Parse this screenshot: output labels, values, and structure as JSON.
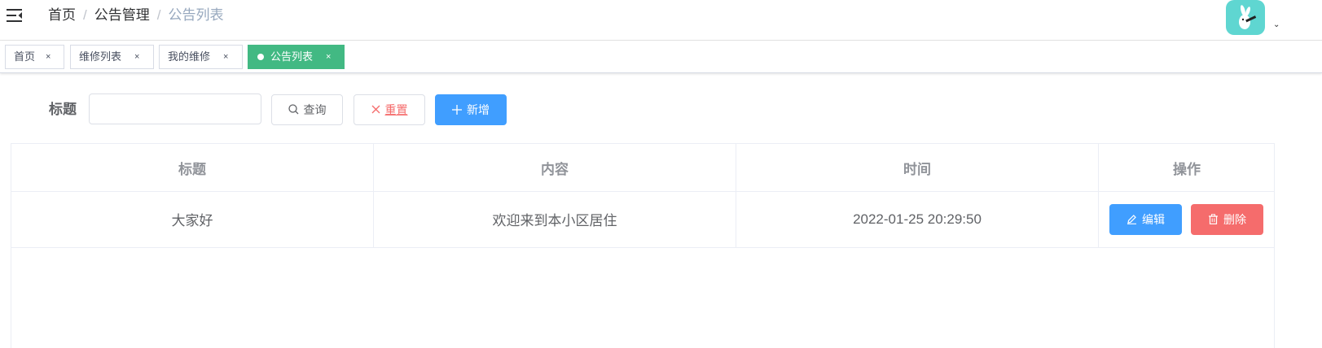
{
  "navbar": {
    "breadcrumb": [
      "首页",
      "公告管理",
      "公告列表"
    ],
    "separator": "/",
    "avatar_caret": "⌄"
  },
  "tags": [
    {
      "label": "首页",
      "close": "×",
      "active": false
    },
    {
      "label": "维修列表",
      "close": "×",
      "active": false
    },
    {
      "label": "我的维修",
      "close": "×",
      "active": false
    },
    {
      "label": "公告列表",
      "close": "×",
      "active": true
    }
  ],
  "filter": {
    "title_label": "标题",
    "title_value": "",
    "title_placeholder": "",
    "search_label": "查询",
    "reset_label": "重置",
    "add_label": "新增"
  },
  "table": {
    "headers": [
      "标题",
      "内容",
      "时间",
      "操作"
    ],
    "rows": [
      {
        "title": "大家好",
        "content": "欢迎来到本小区居住",
        "time": "2022-01-25 20:29:50",
        "edit_label": "编辑",
        "delete_label": "删除"
      }
    ]
  },
  "colors": {
    "primary": "#409eff",
    "danger": "#f56c6c",
    "active_tag": "#42b983",
    "avatar_bg": "#5fd6d1"
  },
  "icons": [
    "hamburger-icon",
    "search-icon",
    "close-icon",
    "plus-icon",
    "edit-icon",
    "delete-icon"
  ]
}
